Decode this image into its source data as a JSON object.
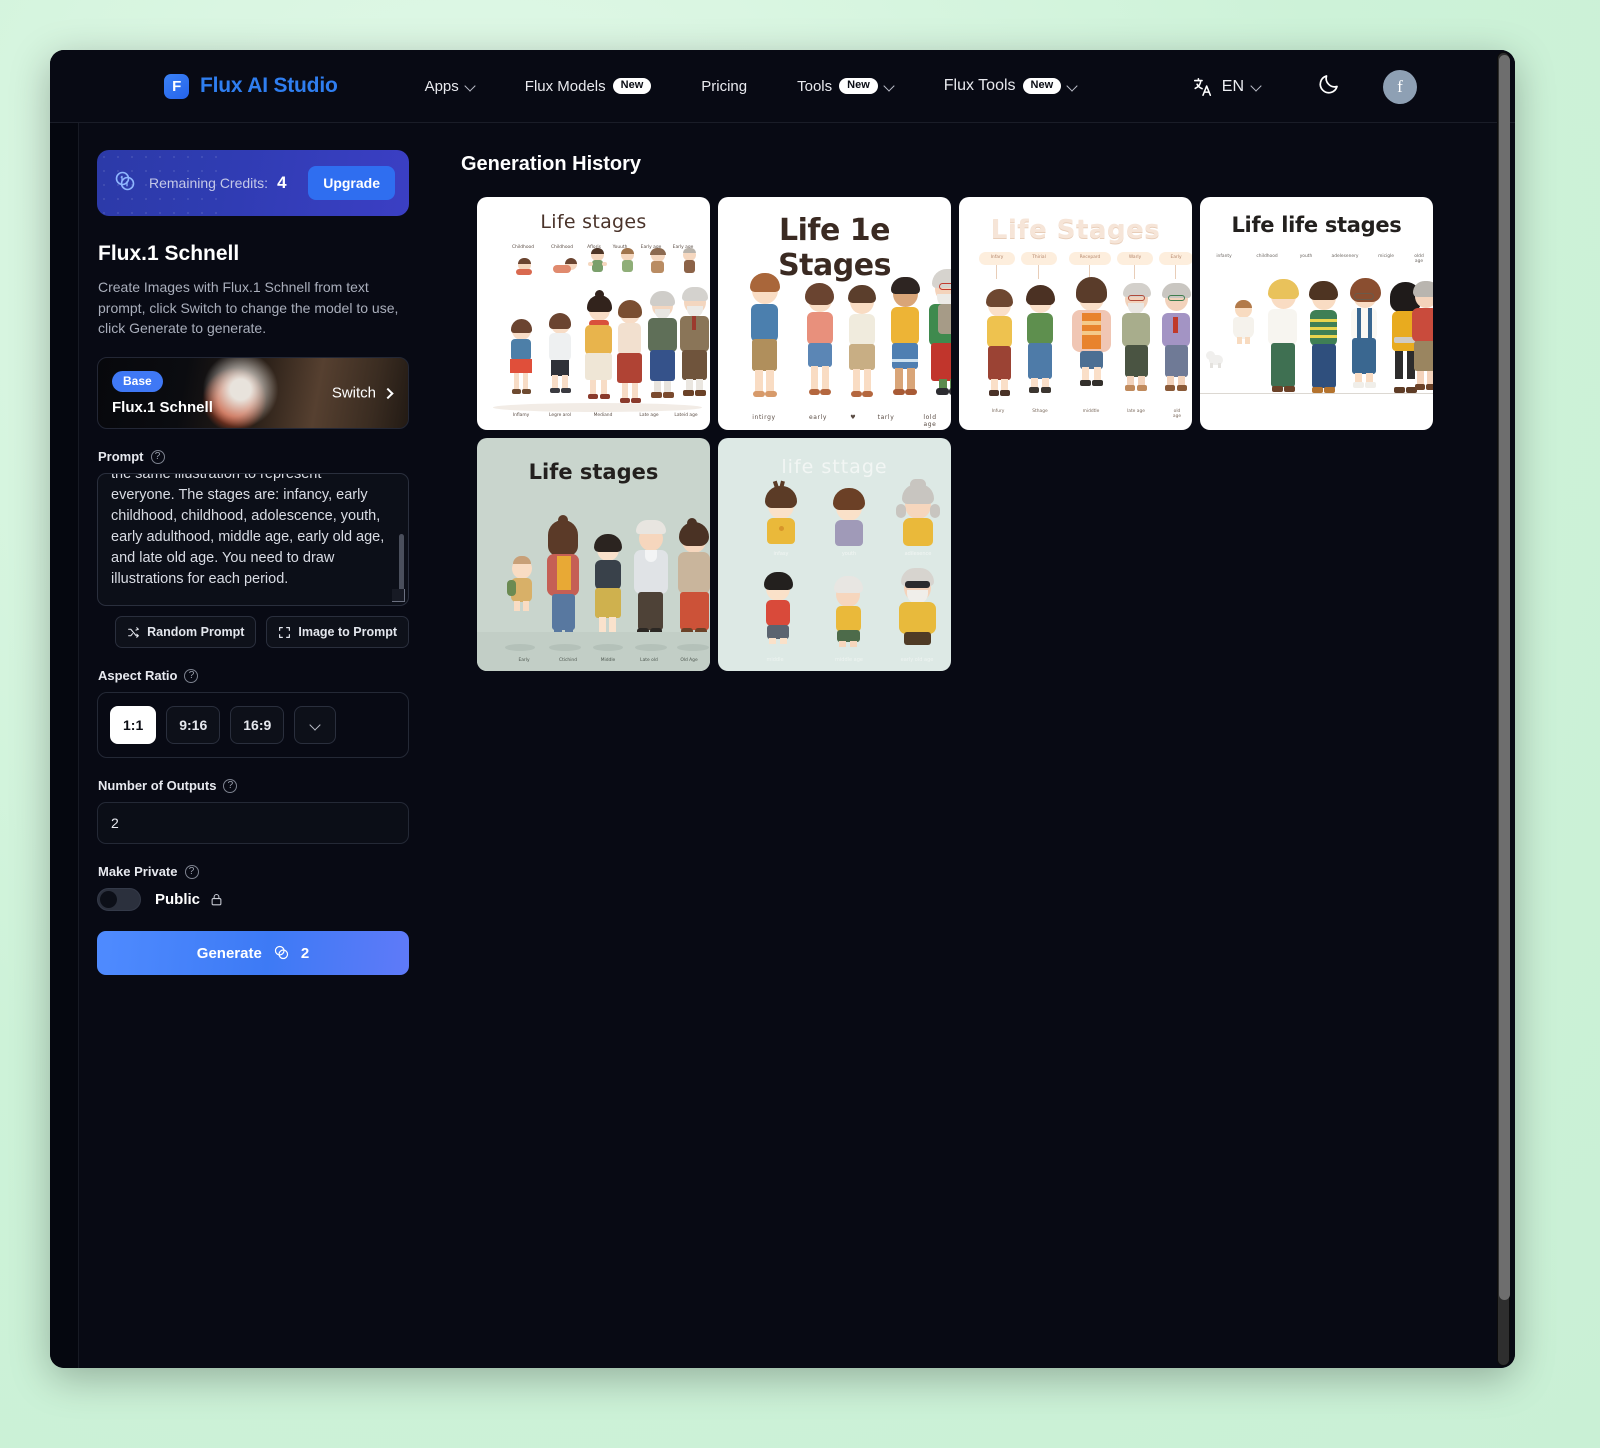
{
  "window": {
    "scroll_position": "top"
  },
  "nav": {
    "brand": {
      "logo_letter": "F",
      "name": "Flux AI Studio"
    },
    "links": [
      {
        "label": "Apps",
        "badge": "",
        "has_chevron": true
      },
      {
        "label": "Flux Models",
        "badge": "New",
        "has_chevron": false
      },
      {
        "label": "Pricing",
        "badge": "",
        "has_chevron": false
      },
      {
        "label": "Tools",
        "badge": "New",
        "has_chevron": true
      },
      {
        "label": "Flux Tools",
        "badge": "New",
        "has_chevron": true
      }
    ],
    "language": {
      "code": "EN",
      "icon": "translate-icon"
    },
    "theme_toggle": {
      "icon": "moon-icon"
    },
    "avatar": {
      "letter": "f"
    }
  },
  "sidebar": {
    "credits": {
      "icon": "coins-icon",
      "label": "Remaining Credits:",
      "value": "4",
      "upgrade_label": "Upgrade"
    },
    "model": {
      "title": "Flux.1 Schnell",
      "description": "Create Images with Flux.1 Schnell from text prompt, click Switch to change the model to use, click Generate to generate.",
      "card": {
        "pill": "Base",
        "name": "Flux.1 Schnell",
        "switch_label": "Switch"
      }
    },
    "prompt": {
      "label": "Prompt",
      "value": "the same illustration to represent everyone. The stages are: infancy, early childhood, childhood, adolescence, youth, early adulthood, middle age, early old age, and late old age. You need to draw illustrations for each period.",
      "random_label": "Random Prompt",
      "image_to_prompt_label": "Image to Prompt"
    },
    "aspect_ratio": {
      "label": "Aspect Ratio",
      "options": [
        "1:1",
        "9:16",
        "16:9"
      ],
      "selected": "1:1",
      "more_icon": "chevron-down-icon"
    },
    "outputs": {
      "label": "Number of Outputs",
      "value": "2"
    },
    "privacy": {
      "label": "Make Private",
      "state_label": "Public",
      "icon": "lock-icon",
      "enabled": false
    },
    "generate": {
      "label": "Generate",
      "cost": "2",
      "icon": "coins-icon"
    }
  },
  "main": {
    "title": "Generation History",
    "cards": [
      {
        "id": "card-1",
        "title": "Life stages",
        "title_color": "#4a332a",
        "bg": "#ffffff",
        "layout": "two-row",
        "top_captions": [
          "Childhood",
          "Childhood",
          "Afloris",
          "Youuth",
          "Early age",
          "Early age"
        ],
        "bottom_captions": [
          "Inflamy",
          "Legre arol",
          "Mediand",
          "",
          "Late age",
          "Lateid age"
        ]
      },
      {
        "id": "card-2",
        "title": "Life 1e Stages",
        "title_color": "#3a2a22",
        "bg": "#ffffff",
        "layout": "single-row",
        "bottom_captions": [
          "intirgy",
          "early",
          "♥",
          "tarly",
          "lold age"
        ]
      },
      {
        "id": "card-3",
        "title": "Life Stages",
        "title_color": "#f0ded2",
        "bg": "#ffffff",
        "layout": "labeled-row",
        "top_captions": [
          "Infary",
          "Thirial",
          "Recepard",
          "Warly",
          "Early"
        ],
        "bottom_captions": [
          "Infury",
          "Sthage",
          "middtle",
          "late age",
          "old age"
        ]
      },
      {
        "id": "card-4",
        "title": "Life life stages",
        "title_color": "#23201e",
        "bg": "#ffffff",
        "layout": "single-row",
        "top_captions": [
          "infanty",
          "childhood",
          "youth",
          "adelesenery",
          "micigle",
          "oldd age"
        ]
      },
      {
        "id": "card-5",
        "title": "Life stages",
        "title_color": "#23201e",
        "bg": "#ccd7cf",
        "layout": "single-row",
        "bottom_captions": [
          "Early",
          "Ctichind",
          "Middle",
          "Late old",
          "Old Age"
        ]
      },
      {
        "id": "card-6",
        "title": "life sttage",
        "title_color": "#ffffff",
        "bg": "#dfe9e5",
        "layout": "grid-2x3",
        "top_captions": [
          "infasy",
          "youth",
          "adilesence"
        ],
        "bottom_captions": [
          "middle",
          "middle age",
          "early old age"
        ]
      }
    ]
  },
  "colors": {
    "page_bg": "#cdf2d8",
    "window_bg": "#05070f",
    "panel_bg": "#080a14",
    "accent_blue": "#2f6ef0",
    "credits_gradient_from": "#2c3aa8",
    "credits_gradient_to": "#3b3fc4",
    "text_primary": "#ffffff",
    "text_muted": "#a9aebb"
  }
}
